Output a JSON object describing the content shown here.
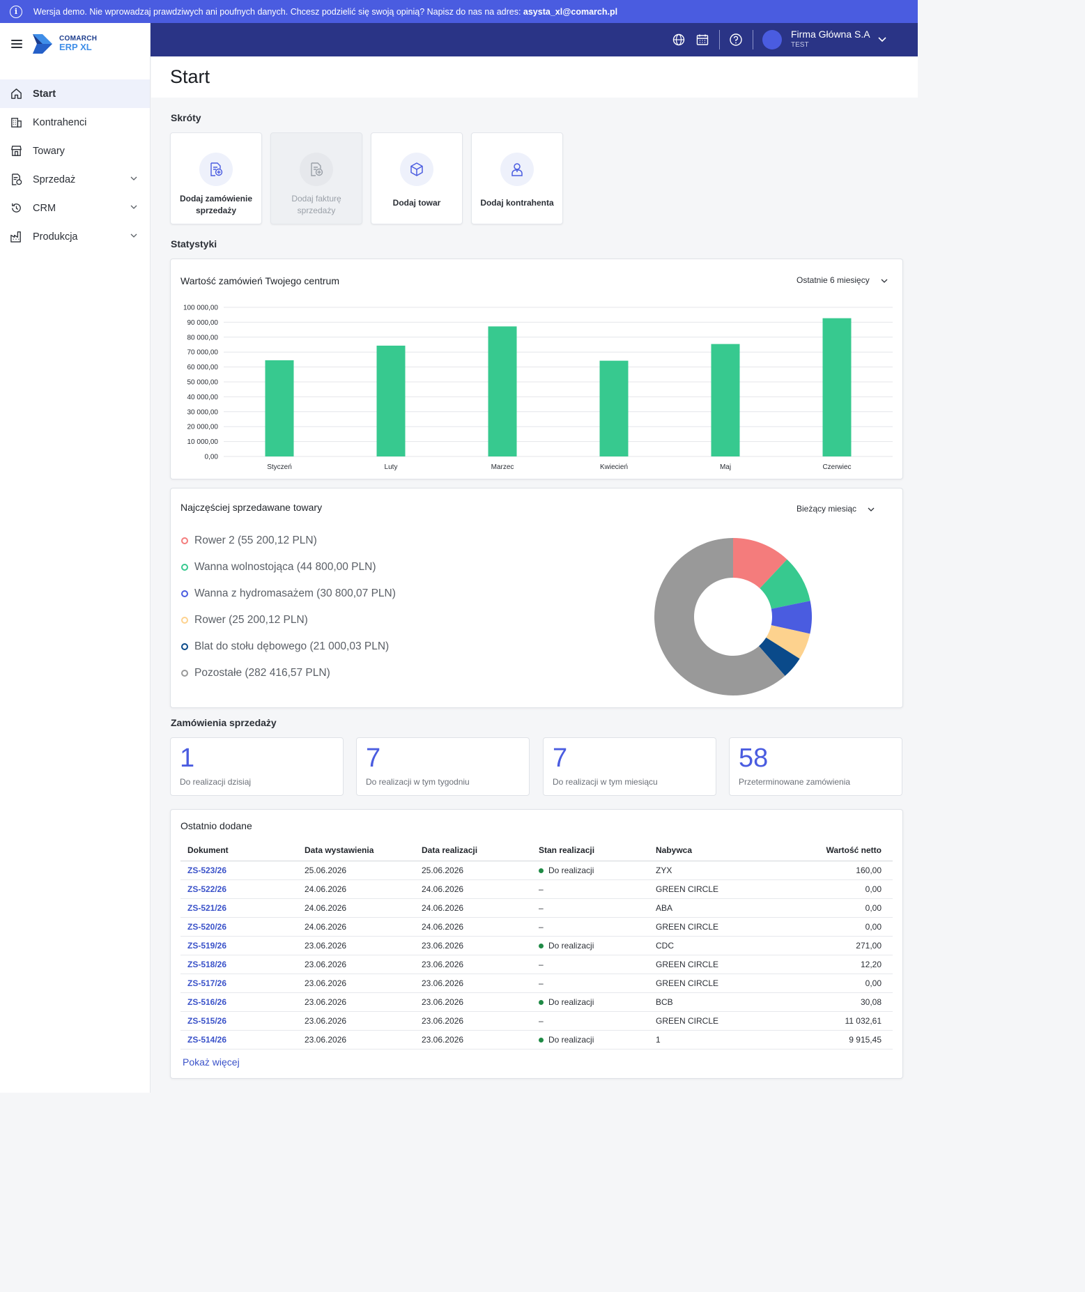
{
  "banner": {
    "text": "Wersja demo. Nie wprowadzaj prawdziwych ani poufnych danych. Chcesz podzielić się swoją opinią? Napisz do nas na adres: ",
    "email": "asysta_xl@comarch.pl"
  },
  "brand": {
    "line1": "COMARCH",
    "line2": "ERP XL"
  },
  "nav": [
    {
      "label": "Start",
      "icon": "home-icon",
      "active": true
    },
    {
      "label": "Kontrahenci",
      "icon": "building-icon"
    },
    {
      "label": "Towary",
      "icon": "store-icon"
    },
    {
      "label": "Sprzedaż",
      "icon": "sales-document-icon",
      "expandable": true
    },
    {
      "label": "CRM",
      "icon": "history-icon",
      "expandable": true
    },
    {
      "label": "Produkcja",
      "icon": "factory-icon",
      "expandable": true
    }
  ],
  "header": {
    "icons": [
      "globe-icon",
      "calendar-icon",
      "help-icon"
    ],
    "company_name": "Firma Główna S.A",
    "company_env": "TEST"
  },
  "page": {
    "title": "Start"
  },
  "shortcuts": {
    "label": "Skróty",
    "items": [
      {
        "label_line1": "Dodaj zamówienie",
        "label_line2": "sprzedaży",
        "icon": "add-document-icon",
        "disabled": false
      },
      {
        "label_line1": "Dodaj fakturę",
        "label_line2": "sprzedaży",
        "icon": "add-document-icon",
        "disabled": true
      },
      {
        "label_line1": "Dodaj towar",
        "label_line2": "",
        "icon": "box-icon",
        "disabled": false
      },
      {
        "label_line1": "Dodaj kontrahenta",
        "label_line2": "",
        "icon": "person-icon",
        "disabled": false
      }
    ]
  },
  "stats": {
    "label": "Statystyki"
  },
  "orders_chart": {
    "title": "Wartość zamówień Twojego centrum",
    "period": "Ostatnie 6 miesięcy",
    "bar_color": "#37c98f"
  },
  "chart_data": {
    "type": "bar",
    "categories": [
      "Styczeń",
      "Luty",
      "Marzec",
      "Kwiecień",
      "Maj",
      "Czerwiec"
    ],
    "values": [
      64500,
      74300,
      87200,
      64200,
      75400,
      92700
    ],
    "ylim": [
      0,
      100000
    ],
    "yticks": [
      "0,00",
      "10 000,00",
      "20 000,00",
      "30 000,00",
      "40 000,00",
      "50 000,00",
      "60 000,00",
      "70 000,00",
      "80 000,00",
      "90 000,00",
      "100 000,00"
    ],
    "grid": true,
    "xlabel": "",
    "ylabel": ""
  },
  "top_products": {
    "title": "Najczęściej sprzedawane towary",
    "period": "Bieżący miesiąc",
    "items": [
      {
        "label": "Rower 2 (55 200,12 PLN)",
        "value": 55200.12,
        "color": "#f47c7c"
      },
      {
        "label": "Wanna wolnostojąca (44 800,00 PLN)",
        "value": 44800.0,
        "color": "#37c98f"
      },
      {
        "label": "Wanna z hydromasażem (30 800,07 PLN)",
        "value": 30800.07,
        "color": "#4a5ce0"
      },
      {
        "label": "Rower (25 200,12 PLN)",
        "value": 25200.12,
        "color": "#fdd28e"
      },
      {
        "label": "Blat do stołu dębowego (21 000,03 PLN)",
        "value": 21000.03,
        "color": "#0a4a8a"
      },
      {
        "label": "Pozostałe (282 416,57 PLN)",
        "value": 282416.57,
        "color": "#999999"
      }
    ]
  },
  "sales_orders": {
    "label": "Zamówienia sprzedaży",
    "kpis": [
      {
        "value": "1",
        "caption": "Do realizacji dzisiaj"
      },
      {
        "value": "7",
        "caption": "Do realizacji w tym tygodniu"
      },
      {
        "value": "7",
        "caption": "Do realizacji w tym miesiącu"
      },
      {
        "value": "58",
        "caption": "Przeterminowane zamówienia"
      }
    ]
  },
  "recent": {
    "title": "Ostatnio dodane",
    "columns": [
      "Dokument",
      "Data wystawienia",
      "Data realizacji",
      "Stan realizacji",
      "Nabywca",
      "Wartość netto"
    ],
    "rows": [
      {
        "doc": "ZS-523/26",
        "issued": "25.06.2026",
        "due": "25.06.2026",
        "status": "Do realizacji",
        "buyer": "ZYX",
        "net": "160,00"
      },
      {
        "doc": "ZS-522/26",
        "issued": "24.06.2026",
        "due": "24.06.2026",
        "status": "–",
        "buyer": "GREEN CIRCLE",
        "net": "0,00"
      },
      {
        "doc": "ZS-521/26",
        "issued": "24.06.2026",
        "due": "24.06.2026",
        "status": "–",
        "buyer": "ABA",
        "net": "0,00"
      },
      {
        "doc": "ZS-520/26",
        "issued": "24.06.2026",
        "due": "24.06.2026",
        "status": "–",
        "buyer": "GREEN CIRCLE",
        "net": "0,00"
      },
      {
        "doc": "ZS-519/26",
        "issued": "23.06.2026",
        "due": "23.06.2026",
        "status": "Do realizacji",
        "buyer": "CDC",
        "net": "271,00"
      },
      {
        "doc": "ZS-518/26",
        "issued": "23.06.2026",
        "due": "23.06.2026",
        "status": "–",
        "buyer": "GREEN CIRCLE",
        "net": "12,20"
      },
      {
        "doc": "ZS-517/26",
        "issued": "23.06.2026",
        "due": "23.06.2026",
        "status": "–",
        "buyer": "GREEN CIRCLE",
        "net": "0,00"
      },
      {
        "doc": "ZS-516/26",
        "issued": "23.06.2026",
        "due": "23.06.2026",
        "status": "Do realizacji",
        "buyer": "BCB",
        "net": "30,08"
      },
      {
        "doc": "ZS-515/26",
        "issued": "23.06.2026",
        "due": "23.06.2026",
        "status": "–",
        "buyer": "GREEN CIRCLE",
        "net": "11 032,61"
      },
      {
        "doc": "ZS-514/26",
        "issued": "23.06.2026",
        "due": "23.06.2026",
        "status": "Do realizacji",
        "buyer": "1",
        "net": "9 915,45"
      }
    ],
    "show_more": "Pokaż więcej"
  }
}
